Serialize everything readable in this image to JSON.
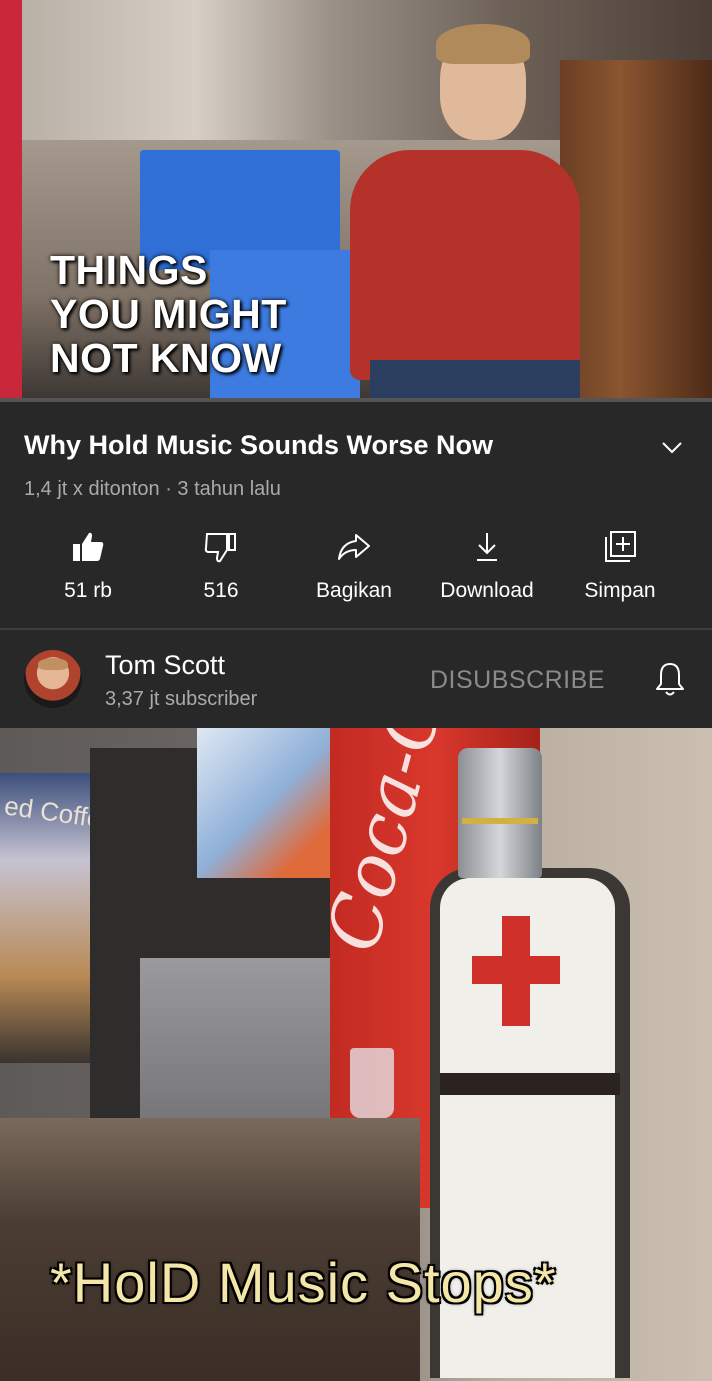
{
  "video": {
    "overlay_lines": [
      "THINGS",
      "YOU MIGHT",
      "NOT KNOW"
    ]
  },
  "details": {
    "title": "Why Hold Music Sounds Worse Now",
    "meta": "1,4 jt x ditonton · 3 tahun lalu"
  },
  "actions": [
    {
      "icon": "thumbs-up-icon",
      "label": "51 rb"
    },
    {
      "icon": "thumbs-down-icon",
      "label": "516"
    },
    {
      "icon": "share-icon",
      "label": "Bagikan"
    },
    {
      "icon": "download-icon",
      "label": "Download"
    },
    {
      "icon": "save-playlist-icon",
      "label": "Simpan"
    }
  ],
  "channel": {
    "name": "Tom Scott",
    "subscribers": "3,37 jt subscriber",
    "subscribe_button": "DISUBSCRIBE"
  },
  "meme": {
    "caption": "*HolD Music Stops*",
    "sign_text": "ed Coffee",
    "logo_text": "Coca-Cola"
  },
  "colors": {
    "background": "#282828",
    "accent_red": "#c8283a",
    "secondary_text": "#aaaaaa"
  }
}
